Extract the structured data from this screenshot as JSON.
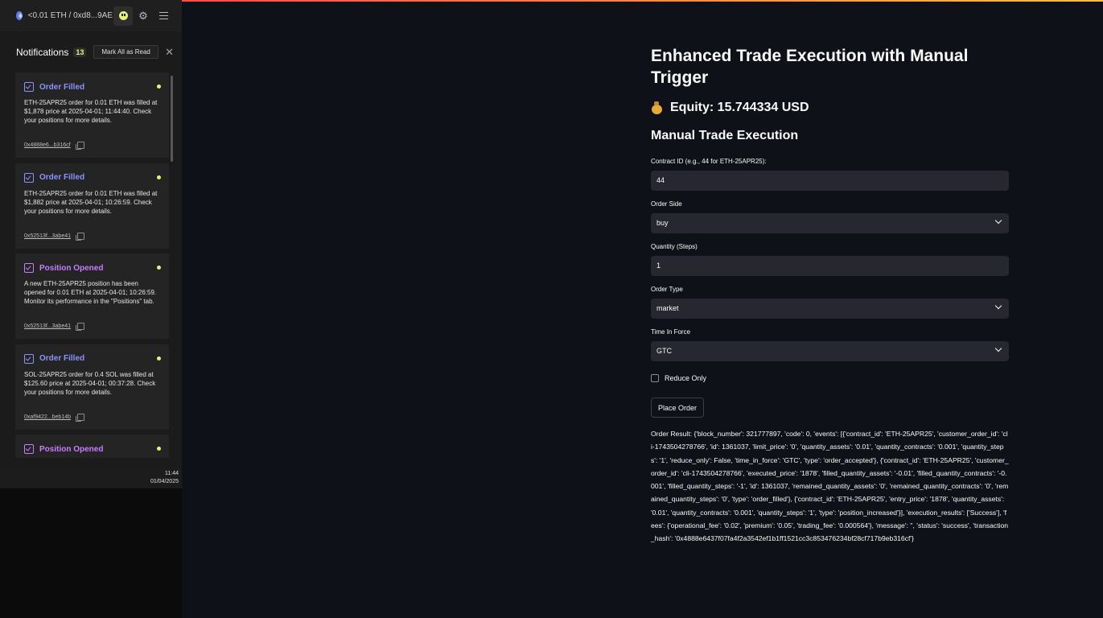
{
  "wallet": {
    "address_label": "<0.01 ETH / 0xd8...9AE"
  },
  "notifications": {
    "title": "Notifications",
    "count": "13",
    "mark_all_read": "Mark All as Read",
    "close": "✕",
    "items": [
      {
        "title": "Order Filled",
        "type": "order",
        "body": "ETH-25APR25 order for 0.01 ETH was filled at $1,878 price at 2025-04-01; 11:44:40. Check your positions for more details.",
        "hash": "0x4888e6...b316cf"
      },
      {
        "title": "Order Filled",
        "type": "order",
        "body": "ETH-25APR25 order for 0.01 ETH was filled at $1,882 price at 2025-04-01; 10:26:59. Check your positions for more details.",
        "hash": "0x52513f...3abe41"
      },
      {
        "title": "Position Opened",
        "type": "position",
        "body": "A new ETH-25APR25 position has been opened for 0.01 ETH at 2025-04-01; 10:26:59. Monitor its performance in the \"Positions\" tab.",
        "hash": "0x52513f...3abe41"
      },
      {
        "title": "Order Filled",
        "type": "order",
        "body": "SOL-25APR25 order for 0.4 SOL was filled at $125.60 price at 2025-04-01; 00:37:28. Check your positions for more details.",
        "hash": "0xaf9422...beb14b"
      },
      {
        "title": "Position Opened",
        "type": "position",
        "body": "",
        "hash": ""
      }
    ]
  },
  "clock": {
    "time": "11:44",
    "date": "01/04/2025"
  },
  "main": {
    "title": "Enhanced Trade Execution with Manual Trigger",
    "equity": "Equity: 15.744334 USD",
    "section_title": "Manual Trade Execution",
    "contract_label": "Contract ID (e.g., 44 for ETH-25APR25):",
    "contract_value": "44",
    "side_label": "Order Side",
    "side_value": "buy",
    "quantity_label": "Quantity (Steps)",
    "quantity_value": "1",
    "type_label": "Order Type",
    "type_value": "market",
    "tif_label": "Time In Force",
    "tif_value": "GTC",
    "reduce_only_label": "Reduce Only",
    "place_order_label": "Place Order",
    "result_text": "Order Result: {'block_number': 321777897, 'code': 0, 'events': [{'contract_id': 'ETH-25APR25', 'customer_order_id': 'cli-1743504278766', 'id': 1361037, 'limit_price': '0', 'quantity_assets': '0.01', 'quantity_contracts': '0.001', 'quantity_steps': '1', 'reduce_only': False, 'time_in_force': 'GTC', 'type': 'order_accepted'}, {'contract_id': 'ETH-25APR25', 'customer_order_id': 'cli-1743504278766', 'executed_price': '1878', 'filled_quantity_assets': '-0.01', 'filled_quantity_contracts': '-0.001', 'filled_quantity_steps': '-1', 'id': 1361037, 'remained_quantity_assets': '0', 'remained_quantity_contracts': '0', 'remained_quantity_steps': '0', 'type': 'order_filled'}, {'contract_id': 'ETH-25APR25', 'entry_price': '1878', 'quantity_assets': '0.01', 'quantity_contracts': '0.001', 'quantity_steps': '1', 'type': 'position_increased'}], 'execution_results': ['Success'], 'fees': {'operational_fee': '0.02', 'premium': '0.05', 'trading_fee': '0.000564'}, 'message': '', 'status': 'success', 'transaction_hash': '0x4888e6437f07fa4f2a3542ef1b1ff1521cc3c853476234bf28cf717b9eb316cf'}"
  },
  "colors": {
    "accent_order": "#8a93ff",
    "accent_position": "#c77dff",
    "unread_dot": "#e8f27a",
    "background": "#0e1117",
    "input_bg": "#262730"
  },
  "icons": [
    "eth-icon",
    "notification-face-icon",
    "gear-icon",
    "hamburger-menu-icon",
    "close-icon",
    "order-check-icon",
    "position-check-icon",
    "copy-icon",
    "money-bag-icon",
    "chevron-down-icon"
  ]
}
